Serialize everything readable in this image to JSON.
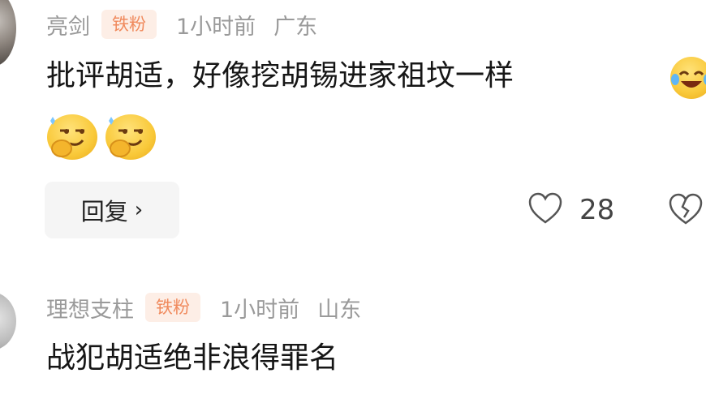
{
  "comments": [
    {
      "username": "亮剑",
      "badge": "铁粉",
      "time": "1小时前",
      "location": "广东",
      "text": "批评胡适，好像挖胡锡进家祖坟一样",
      "reply_label": "回复",
      "like_count": "28"
    },
    {
      "username": "理想支柱",
      "badge": "铁粉",
      "time": "1小时前",
      "location": "山东",
      "text": "战犯胡适绝非浪得罪名"
    }
  ],
  "icons": {
    "like": "heart-outline-icon",
    "dislike": "broken-heart-icon",
    "reply_chevron": "chevron-right-icon"
  },
  "colors": {
    "meta_text": "#9a9a9a",
    "badge_bg": "#fdeee6",
    "badge_text": "#f08a5d",
    "body_text": "#161616",
    "reply_bg": "#f5f5f5"
  }
}
